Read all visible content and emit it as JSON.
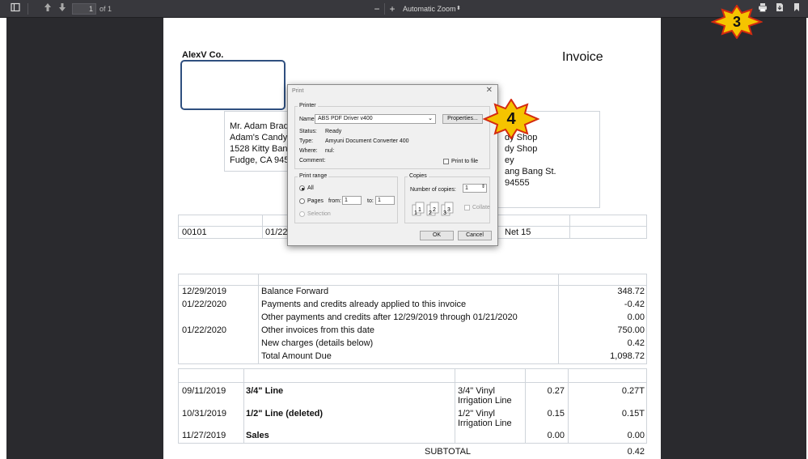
{
  "toolbar": {
    "page_number": "1",
    "page_of": "of 1",
    "zoom_out": "−",
    "zoom_in": "+",
    "zoom_level": "Automatic Zoom",
    "zoom_arrow": "⬍",
    "sidebar_icon": "sidebar-toggle-icon",
    "prev_icon": "arrow-up-icon",
    "next_icon": "arrow-down-icon",
    "print_icon": "printer-icon",
    "download_icon": "download-icon",
    "bookmark_icon": "bookmark-icon"
  },
  "invoice": {
    "company": "AlexV Co.",
    "title": "Invoice",
    "bill_to": [
      "Mr. Adam Bradl",
      "Adam's Candy S",
      "1528 Kitty Bang",
      "Fudge, CA  945"
    ],
    "ship_to": [
      "dy Shop",
      "dy Shop",
      "ey",
      "ang Bang St.",
      "94555"
    ],
    "info_row": {
      "number": "00101",
      "date": "01/22",
      "terms": "Net 15"
    },
    "summary": [
      {
        "date": "12/29/2019",
        "desc": "Balance Forward",
        "amount": "348.72"
      },
      {
        "date": "01/22/2020",
        "desc": "Payments and credits already applied to this invoice",
        "amount": "-0.42"
      },
      {
        "date": "",
        "desc": "Other payments and credits after 12/29/2019 through 01/21/2020",
        "amount": "0.00"
      },
      {
        "date": "01/22/2020",
        "desc": "Other invoices from this date",
        "amount": "750.00"
      },
      {
        "date": "",
        "desc": "New charges (details below)",
        "amount": "0.42"
      },
      {
        "date": "",
        "desc": "Total Amount Due",
        "amount": "1,098.72"
      }
    ],
    "lines": [
      {
        "date": "09/11/2019",
        "item": "3/4\" Line",
        "desc1": "3/4\"  Vinyl",
        "desc2": "Irrigation Line",
        "rate": "0.27",
        "amount": "0.27T"
      },
      {
        "date": "10/31/2019",
        "item": "1/2\" Line (deleted)",
        "desc1": "1/2\"  Vinyl",
        "desc2": "Irrigation Line",
        "rate": "0.15",
        "amount": "0.15T"
      },
      {
        "date": "11/27/2019",
        "item": "Sales",
        "desc1": "",
        "desc2": "",
        "rate": "0.00",
        "amount": "0.00"
      }
    ],
    "subtotal_label": "SUBTOTAL",
    "subtotal_value": "0.42"
  },
  "dialog": {
    "title": "Print",
    "close": "✕",
    "printer_group": "Printer",
    "name_label": "Name:",
    "printer_name": "ABS PDF Driver v400",
    "properties": "Properties...",
    "status_label": "Status:",
    "status_value": "Ready",
    "type_label": "Type:",
    "type_value": "Amyuni Document Converter 400",
    "where_label": "Where:",
    "where_value": "nul:",
    "comment_label": "Comment:",
    "print_to_file": "Print to file",
    "range_group": "Print range",
    "range_all": "All",
    "range_pages": "Pages",
    "from_label": "from:",
    "from_value": "1",
    "to_label": "to:",
    "to_value": "1",
    "range_selection": "Selection",
    "copies_group": "Copies",
    "copies_label": "Number of copies:",
    "copies_value": "1",
    "collate": "Collate",
    "ok": "OK",
    "cancel": "Cancel"
  },
  "callouts": {
    "three": "3",
    "four": "4",
    "color": "#f5c400",
    "border_color": "#d42a10"
  }
}
